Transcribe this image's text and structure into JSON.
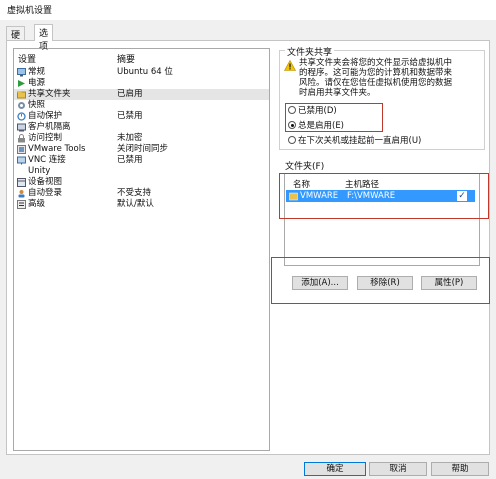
{
  "window": {
    "title": "虚拟机设置"
  },
  "tabs": [
    {
      "label": "硬件"
    },
    {
      "label": "选项"
    }
  ],
  "list": {
    "headers": {
      "setting": "设置",
      "summary": "摘要"
    },
    "items": [
      {
        "icon": "computer-icon",
        "name": "常规",
        "summary": "Ubuntu 64 位"
      },
      {
        "icon": "power-icon",
        "name": "电源",
        "summary": ""
      },
      {
        "icon": "shared-folder-icon",
        "name": "共享文件夹",
        "summary": "已启用"
      },
      {
        "icon": "snapshot-icon",
        "name": "快照",
        "summary": ""
      },
      {
        "icon": "autoprotect-icon",
        "name": "自动保护",
        "summary": "已禁用"
      },
      {
        "icon": "guest-isolation-icon",
        "name": "客户机隔离",
        "summary": ""
      },
      {
        "icon": "access-control-icon",
        "name": "访问控制",
        "summary": "未加密"
      },
      {
        "icon": "vmware-tools-icon",
        "name": "VMware Tools",
        "summary": "关闭时间同步"
      },
      {
        "icon": "vnc-icon",
        "name": "VNC 连接",
        "summary": "已禁用"
      },
      {
        "icon": "unity-icon",
        "name": "Unity",
        "summary": ""
      },
      {
        "icon": "device-view-icon",
        "name": "设备视图",
        "summary": ""
      },
      {
        "icon": "autologin-icon",
        "name": "自动登录",
        "summary": "不受支持"
      },
      {
        "icon": "advanced-icon",
        "name": "高级",
        "summary": "默认/默认"
      }
    ]
  },
  "sharing": {
    "title": "文件夹共享",
    "warning_lines": [
      "共享文件夹会将您的文件显示给虚拟机中",
      "的程序。这可能为您的计算机和数据带来",
      "风险。请仅在您信任虚拟机使用您的数据",
      "时启用共享文件夹。"
    ],
    "options": [
      {
        "label": "已禁用(D)",
        "checked": false
      },
      {
        "label": "总是启用(E)",
        "checked": true
      },
      {
        "label": "在下次关机或挂起前一直启用(U)",
        "checked": false
      }
    ]
  },
  "folders": {
    "title": "文件夹(F)",
    "headers": {
      "name": "名称",
      "path": "主机路径"
    },
    "rows": [
      {
        "name": "VMWARE",
        "path": "F:\\VMWARE",
        "enabled": true
      }
    ],
    "buttons": {
      "add": "添加(A)...",
      "remove": "移除(R)",
      "properties": "属性(P)"
    }
  },
  "footer": {
    "ok": "确定",
    "cancel": "取消",
    "help": "帮助"
  },
  "colors": {
    "selection": "#3399ff",
    "highlight_box": "#c0392b",
    "warning": "#f5c400"
  }
}
